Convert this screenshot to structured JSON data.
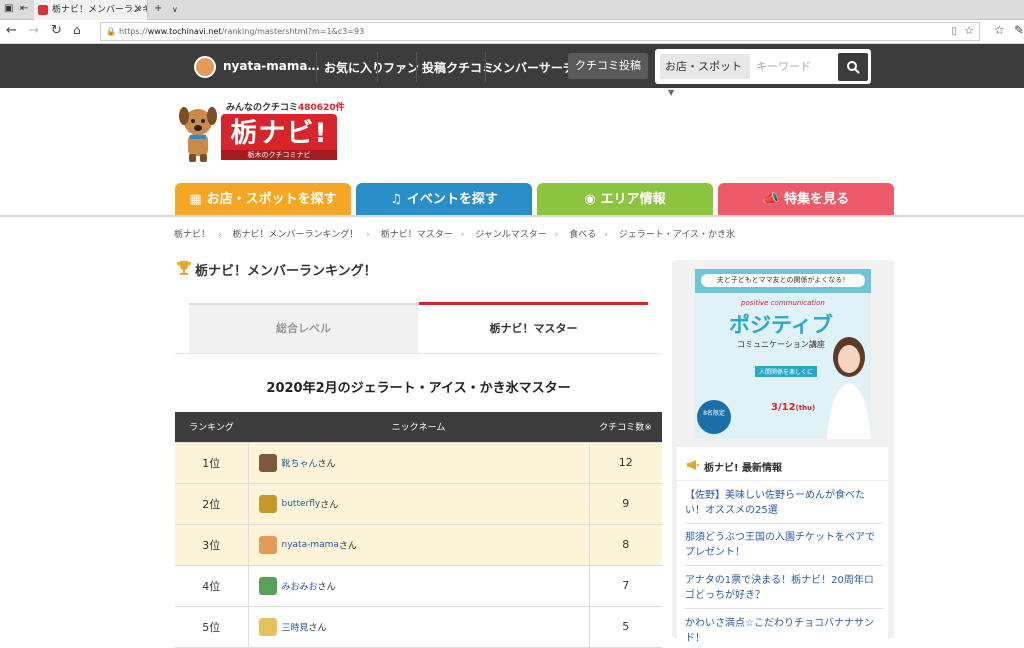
{
  "browser": {
    "tab_title": "栃ナビ！メンバーランキング",
    "url_prefix": "https://",
    "url_domain": "www.tochinavi.net",
    "url_path": "/ranking/mastershtml?m=1&c3=93"
  },
  "sitenav": {
    "username": "nyata-mama…",
    "links": [
      "お気に入り",
      "ファン",
      "投稿クチコミ",
      "メンバーサーチ"
    ],
    "post_button": "クチコミ投稿",
    "shop_select": "お店・スポット",
    "keyword_placeholder": "キーワード"
  },
  "logo": {
    "tagline_prefix": "みんなのクチコミ",
    "tagline_count": "480620件",
    "title": "栃ナビ!",
    "sub": "栃木のクチコミナビ"
  },
  "categories": [
    {
      "label": "お店・スポットを探す",
      "color": "#f5a623"
    },
    {
      "label": "イベントを探す",
      "color": "#2a8fc8"
    },
    {
      "label": "エリア情報",
      "color": "#8cc43f"
    },
    {
      "label": "特集を見る",
      "color": "#ef5a6b"
    }
  ],
  "breadcrumb": [
    "栃ナビ！",
    "栃ナビ！メンバーランキング！",
    "栃ナビ！マスター",
    "ジャンルマスター",
    "食べる",
    "ジェラート・アイス・かき氷"
  ],
  "ranking": {
    "title": "栃ナビ！メンバーランキング！",
    "tabs": {
      "level": "総合レベル",
      "master": "栃ナビ！マスター"
    },
    "month_title": "2020年2月のジェラート・アイス・かき氷マスター",
    "headers": {
      "rank": "ランキング",
      "name": "ニックネーム",
      "count": "クチコミ数※"
    },
    "san": "さん",
    "rows": [
      {
        "rank": "1位",
        "name": "靴ちゃん",
        "count": "12",
        "avatar_color": "#7a5a3a"
      },
      {
        "rank": "2位",
        "name": "butterfly",
        "count": "9",
        "avatar_color": "#c49a2a"
      },
      {
        "rank": "3位",
        "name": "nyata-mama",
        "count": "8",
        "avatar_color": "#e49b57"
      },
      {
        "rank": "4位",
        "name": "みおみお",
        "count": "7",
        "avatar_color": "#5aa05a"
      },
      {
        "rank": "5位",
        "name": "三時見",
        "count": "5",
        "avatar_color": "#e6c25a"
      }
    ]
  },
  "sidebar": {
    "ad": {
      "top_text": "夫と子どもとママ友との関係がよくなる！",
      "script": "positive communication",
      "headline": "ポジティブ",
      "course": "コミュニケーション講座",
      "relation": "人間関係を楽しくに",
      "badge": "8名限定",
      "date": "3/12",
      "date_day": "(thu)"
    },
    "news_title": "栃ナビ! 最新情報",
    "news": [
      "【佐野】美味しい佐野らーめんが食べたい！オススメの25選",
      "那須どうぶつ王国の入園チケットをペアでプレゼント！",
      "アナタの1票で決まる！栃ナビ！20周年ロゴどっちが好き？",
      "かわいさ満点☆こだわりチョコバナナサンド！"
    ]
  }
}
